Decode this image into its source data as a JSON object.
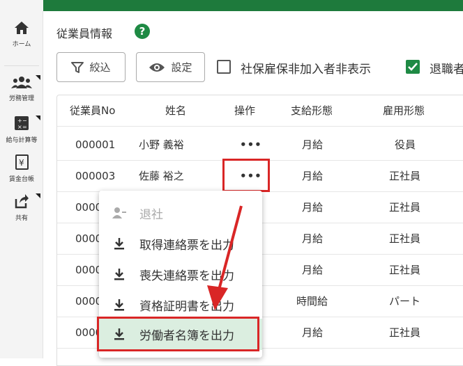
{
  "sidebar": {
    "items": [
      {
        "label": "ホーム",
        "icon": "home-icon"
      },
      {
        "label": "労務管理",
        "icon": "people-icon"
      },
      {
        "label": "給与計算等",
        "icon": "calculator-icon"
      },
      {
        "label": "賃金台帳",
        "icon": "ledger-icon"
      },
      {
        "label": "共有",
        "icon": "share-icon"
      }
    ]
  },
  "page": {
    "title": "従業員情報",
    "help": "?"
  },
  "toolbar": {
    "filter_label": "絞込",
    "settings_label": "設定",
    "hide_uninsured_label": "社保雇保非加入者非表示",
    "hide_uninsured_checked": false,
    "retired_label": "退職者",
    "retired_checked": true
  },
  "table": {
    "headers": [
      "従業員No",
      "姓名",
      "操作",
      "支給形態",
      "雇用形態"
    ],
    "rows": [
      {
        "no": "000001",
        "name": "小野 義裕",
        "op": "•••",
        "pay": "月給",
        "emp": "役員"
      },
      {
        "no": "000003",
        "name": "佐藤 裕之",
        "op": "•••",
        "pay": "月給",
        "emp": "正社員"
      },
      {
        "no": "0000",
        "name": "",
        "op": "",
        "pay": "月給",
        "emp": "正社員"
      },
      {
        "no": "0000",
        "name": "",
        "op": "",
        "pay": "月給",
        "emp": "正社員"
      },
      {
        "no": "0000",
        "name": "",
        "op": "",
        "pay": "月給",
        "emp": "正社員"
      },
      {
        "no": "0000",
        "name": "",
        "op": "",
        "pay": "時間給",
        "emp": "パート"
      },
      {
        "no": "0000",
        "name": "",
        "op": "",
        "pay": "月給",
        "emp": "正社員"
      }
    ]
  },
  "menu": {
    "items": [
      {
        "label": "退社",
        "icon": "person-remove-icon",
        "disabled": true
      },
      {
        "label": "取得連絡票を出力",
        "icon": "download-icon"
      },
      {
        "label": "喪失連絡票を出力",
        "icon": "download-icon"
      },
      {
        "label": "資格証明書を出力",
        "icon": "download-icon"
      },
      {
        "label": "労働者名簿を出力",
        "icon": "download-icon",
        "highlighted": true
      }
    ]
  },
  "colors": {
    "brand": "#1e7a3c",
    "accent": "#1e8a44",
    "annotation": "#d92626",
    "highlight": "#dbeee0"
  }
}
